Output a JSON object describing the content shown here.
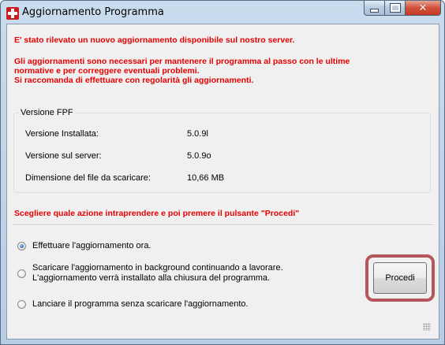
{
  "window": {
    "title": "Aggiornamento Programma"
  },
  "messages": {
    "line1": "E' stato rilevato un nuovo aggiornamento disponibile sul nostro server.",
    "line2": "Gli aggiornamenti sono necessari per mantenere il programma al passo con le ultime",
    "line3": "normative e per correggere eventuali problemi.",
    "line4": "Si raccomanda di effettuare con regolarità gli aggiornamenti."
  },
  "version_group": {
    "title": "Versione FPF",
    "rows": [
      {
        "label": "Versione Installata:",
        "value": "5.0.9l"
      },
      {
        "label": "Versione sul server:",
        "value": "5.0.9o"
      },
      {
        "label": "Dimensione del file da scaricare:",
        "value": "10,66 MB"
      }
    ]
  },
  "instruction": "Scegliere quale azione intraprendere e poi premere il pulsante \"Procedi\"",
  "options": [
    {
      "line1": "Effettuare l'aggiornamento ora.",
      "line2": "",
      "checked": true
    },
    {
      "line1": "Scaricare l'aggiornamento in background continuando a lavorare.",
      "line2": "L'aggiornamento verrà installato alla chiusura del programma.",
      "checked": false
    },
    {
      "line1": "Lanciare il programma senza scaricare l'aggiornamento.",
      "line2": "",
      "checked": false
    }
  ],
  "buttons": {
    "procedi": "Procedi"
  },
  "icons": {
    "app": "red-cross-icon",
    "minimize": "minimize-icon",
    "maximize": "maximize-icon",
    "close": "close-icon"
  },
  "colors": {
    "warning_text": "#e60000",
    "highlight_frame": "#b5565a",
    "radio_selected": "#2a6fb8"
  }
}
